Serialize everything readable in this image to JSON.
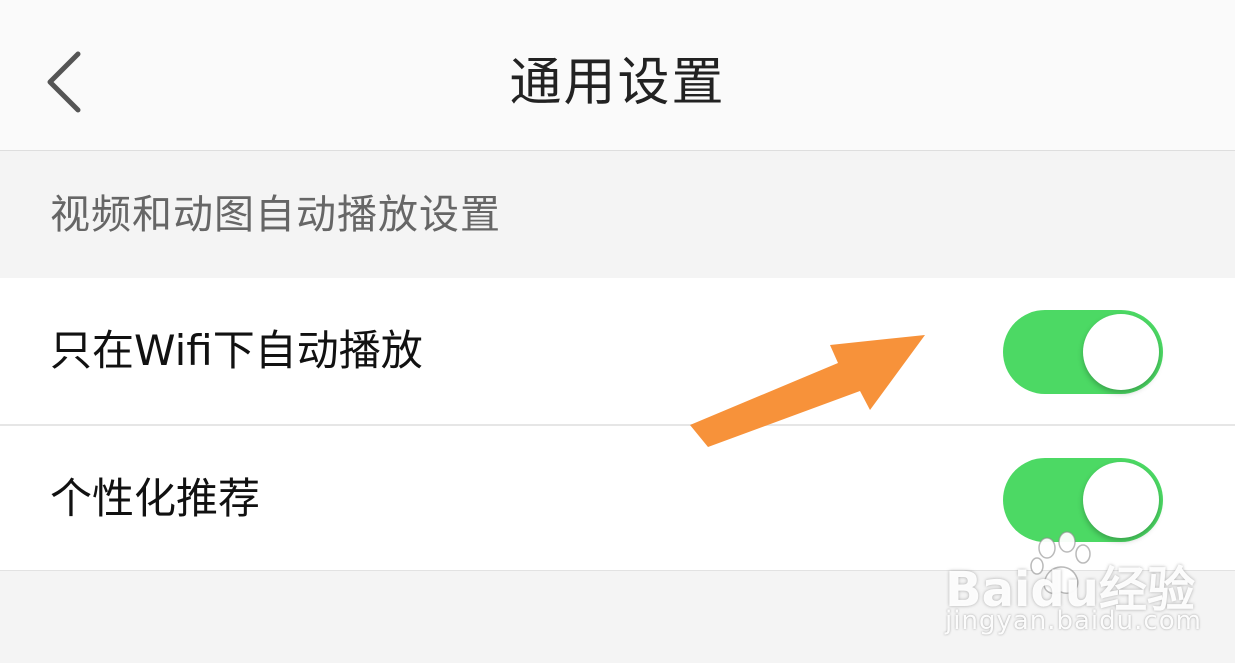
{
  "header": {
    "title": "通用设置",
    "back_icon": "chevron-left-icon"
  },
  "section": {
    "label": "视频和动图自动播放设置"
  },
  "settings": [
    {
      "label": "只在Wifi下自动播放",
      "enabled": true
    },
    {
      "label": "个性化推荐",
      "enabled": true
    }
  ],
  "colors": {
    "toggle_on": "#4cd964",
    "annotation_arrow": "#f7923a",
    "background": "#f4f4f4"
  },
  "watermark": {
    "logo_text": "Baidu经验",
    "url": "jingyan.baidu.com"
  }
}
